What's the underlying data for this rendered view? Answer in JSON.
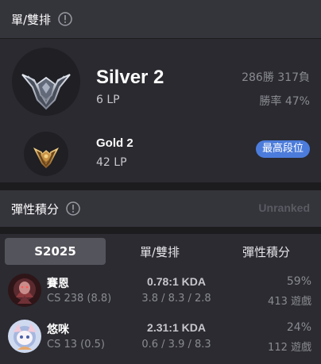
{
  "solo": {
    "title": "單/雙排",
    "current": {
      "tier": "Silver 2",
      "lp": "6 LP",
      "record": "286勝 317負",
      "winrate": "勝率 47%",
      "emblem_icon": "silver-emblem-icon"
    },
    "peak": {
      "tier": "Gold 2",
      "lp": "42 LP",
      "badge": "最高段位",
      "emblem_icon": "gold-emblem-icon"
    }
  },
  "flex": {
    "title": "彈性積分",
    "status": "Unranked"
  },
  "champions": {
    "tabs": [
      "S2025",
      "單/雙排",
      "彈性積分"
    ],
    "active_tab": "S2025",
    "rows": [
      {
        "name": "賽恩",
        "cs": "CS 238 (8.8)",
        "kda": "0.78:1 KDA",
        "kills": "3.8 / 8.3 / 2.8",
        "winrate": "59%",
        "games": "413 遊戲"
      },
      {
        "name": "悠咪",
        "cs": "CS 13 (0.5)",
        "kda": "2.31:1 KDA",
        "kills": "0.6 / 3.9 / 8.3",
        "winrate": "24%",
        "games": "112 遊戲"
      }
    ]
  },
  "colors": {
    "background": "#1c1c1f",
    "card": "#2a2a30",
    "header": "#34343b",
    "badge": "#4c7cdb",
    "muted_text": "#8a8a92"
  }
}
